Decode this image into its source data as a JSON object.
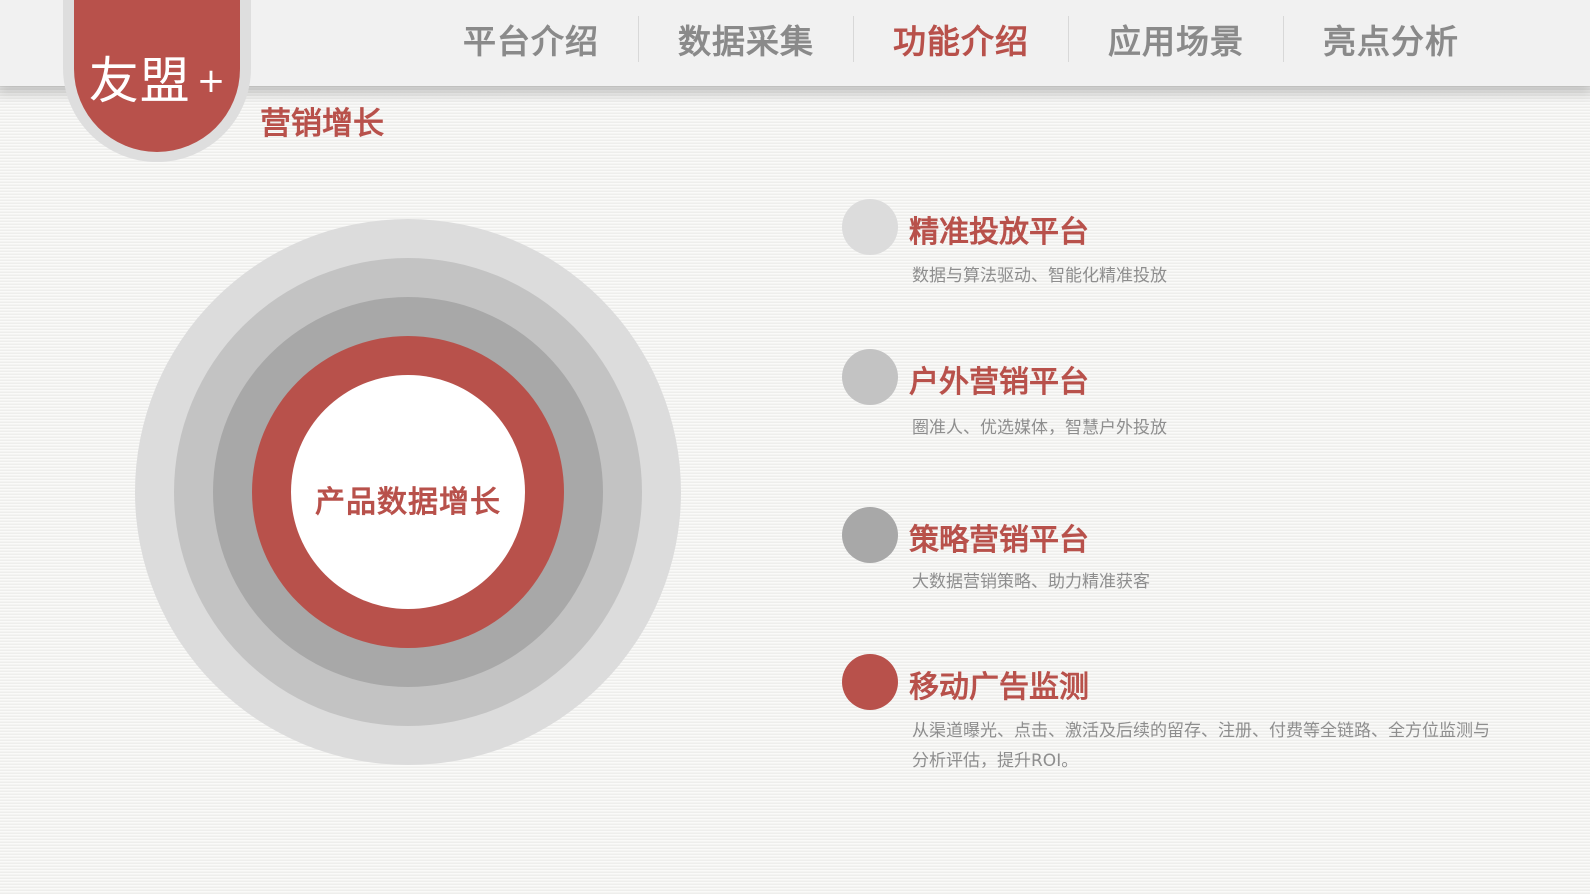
{
  "logo": {
    "text": "友盟",
    "plus": "+"
  },
  "nav": {
    "items": [
      {
        "label": "平台介绍",
        "active": false
      },
      {
        "label": "数据采集",
        "active": false
      },
      {
        "label": "功能介绍",
        "active": true
      },
      {
        "label": "应用场景",
        "active": false
      },
      {
        "label": "亮点分析",
        "active": false
      }
    ]
  },
  "section_title": "营销增长",
  "diagram": {
    "center_label": "产品数据增长"
  },
  "features": [
    {
      "title": "精准投放平台",
      "desc": "数据与算法驱动、智能化精准投放",
      "dot_color": "#dcdcdc"
    },
    {
      "title": "户外营销平台",
      "desc": "圈准人、优选媒体，智慧户外投放",
      "dot_color": "#c3c3c3"
    },
    {
      "title": "策略营销平台",
      "desc": "大数据营销策略、助力精准获客",
      "dot_color": "#a8a8a8"
    },
    {
      "title": "移动广告监测",
      "desc": "从渠道曝光、点击、激活及后续的留存、注册、付费等全链路、全方位监测与分析评估，提升ROI。",
      "dot_color": "#b8514b"
    }
  ],
  "colors": {
    "accent": "#b8514b",
    "nav_inactive": "#8a8a8a",
    "desc_text": "#8e8e8e"
  }
}
